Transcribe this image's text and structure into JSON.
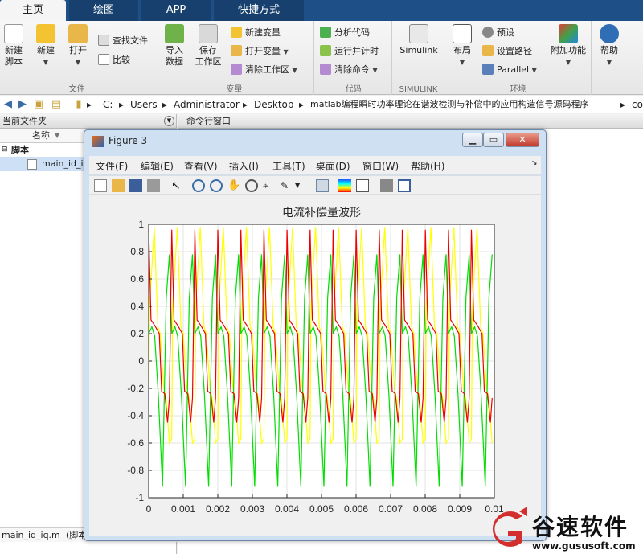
{
  "tabs": [
    {
      "label": "主页",
      "active": true
    },
    {
      "label": "绘图",
      "active": false
    },
    {
      "label": "APP",
      "active": false
    },
    {
      "label": "快捷方式",
      "active": false
    }
  ],
  "ribbon": {
    "file": {
      "label": "文件",
      "new_script": "新建\n脚本",
      "new": "新建",
      "open": "打开",
      "find_files": "查找文件",
      "compare": "比较"
    },
    "variable": {
      "label": "变量",
      "import": "导入\n数据",
      "save_ws": "保存\n工作区",
      "new_var": "新建变量",
      "open_var": "打开变量",
      "clear_ws": "清除工作区"
    },
    "code": {
      "label": "代码",
      "analyze": "分析代码",
      "run_time": "运行并计时",
      "clear_cmd": "清除命令"
    },
    "simulink": {
      "label": "SIMULINK",
      "btn": "Simulink"
    },
    "env": {
      "label": "环境",
      "layout": "布局",
      "prefs": "预设",
      "set_path": "设置路径",
      "parallel": "Parallel",
      "addons": "附加功能"
    },
    "help": {
      "btn": "帮助"
    }
  },
  "address": {
    "crumbs": [
      "C:",
      "Users",
      "Administrator",
      "Desktop",
      "matlab编程瞬时功率理论在谐波检测与补偿中的应用构造信号源码程序",
      "co"
    ]
  },
  "left_pane": {
    "title": "当前文件夹",
    "col_name": "名称",
    "group": "脚本",
    "file": "main_id_i",
    "status_file": "main_id_iq.m",
    "status_type": "(脚本"
  },
  "right_pane": {
    "title": "命令行窗口"
  },
  "figure": {
    "title": "Figure 3",
    "menu": [
      "文件(F)",
      "编辑(E)",
      "查看(V)",
      "插入(I)",
      "工具(T)",
      "桌面(D)",
      "窗口(W)",
      "帮助(H)"
    ]
  },
  "chart_data": {
    "type": "line",
    "title": "电流补偿量波形",
    "xlabel": "",
    "ylabel": "",
    "xlim": [
      0,
      0.01
    ],
    "ylim": [
      -1,
      1
    ],
    "xticks": [
      "0",
      "0.001",
      "0.002",
      "0.003",
      "0.004",
      "0.005",
      "0.006",
      "0.007",
      "0.008",
      "0.009",
      "0.01"
    ],
    "yticks": [
      "1",
      "0.8",
      "0.6",
      "0.4",
      "0.2",
      "0",
      "-0.2",
      "-0.4",
      "-0.6",
      "-0.8",
      "-1"
    ],
    "grid": true,
    "period": 0.000667,
    "colors": {
      "yellow": "#ffff00",
      "green": "#00dd00",
      "red": "#ee0000"
    },
    "series": [
      {
        "color": "#ffff00",
        "shape": [
          [
            0,
            -0.57
          ],
          [
            0.04,
            0.4
          ],
          [
            0.24,
            0.98
          ],
          [
            0.4,
            0.25
          ],
          [
            0.5,
            0.2
          ],
          [
            0.66,
            -0.2
          ],
          [
            0.76,
            -0.28
          ],
          [
            0.9,
            -0.6
          ],
          [
            1.0,
            -0.57
          ]
        ]
      },
      {
        "color": "#00dd00",
        "shape": [
          [
            0,
            0.2
          ],
          [
            0.14,
            0.25
          ],
          [
            0.26,
            0.18
          ],
          [
            0.42,
            -0.25
          ],
          [
            0.6,
            -0.92
          ],
          [
            0.76,
            0.46
          ],
          [
            0.9,
            0.78
          ],
          [
            1.0,
            0.2
          ]
        ]
      },
      {
        "color": "#ee0000",
        "shape": [
          [
            0,
            0.96
          ],
          [
            0.1,
            0.3
          ],
          [
            0.26,
            0.26
          ],
          [
            0.46,
            0.2
          ],
          [
            0.56,
            -0.22
          ],
          [
            0.7,
            -0.24
          ],
          [
            0.82,
            -0.45
          ],
          [
            0.9,
            -0.27
          ],
          [
            1.0,
            0.96
          ]
        ]
      }
    ]
  },
  "watermark": {
    "brand": "谷速软件",
    "url": "www.gususoft.com"
  }
}
